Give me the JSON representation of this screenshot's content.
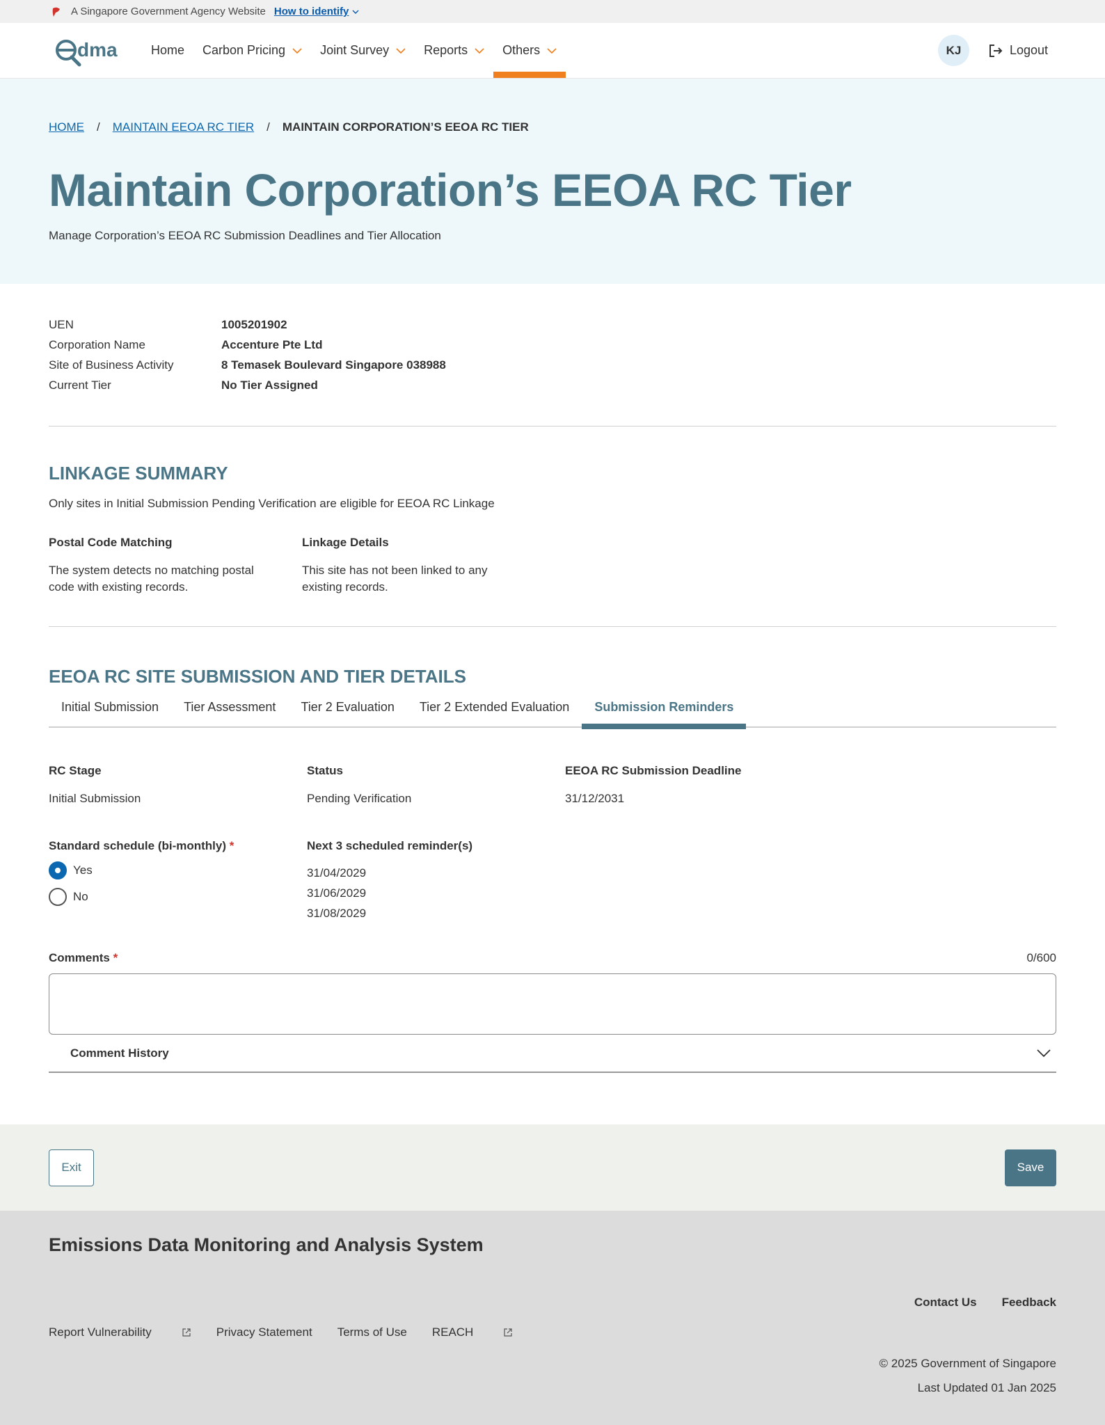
{
  "masthead": {
    "text": "A Singapore Government Agency Website",
    "identify_link": "How to identify"
  },
  "nav": {
    "logo_text": "edma",
    "items": [
      {
        "label": "Home",
        "dropdown": false
      },
      {
        "label": "Carbon Pricing",
        "dropdown": true
      },
      {
        "label": "Joint Survey",
        "dropdown": true
      },
      {
        "label": "Reports",
        "dropdown": true
      },
      {
        "label": "Others",
        "dropdown": true,
        "active": true
      }
    ],
    "avatar_initials": "KJ",
    "logout_label": "Logout"
  },
  "breadcrumb": {
    "home": "HOME",
    "parent": "MAINTAIN EEOA RC TIER",
    "current": "MAINTAIN CORPORATION’S EEOA RC TIER",
    "separator": "/"
  },
  "page": {
    "title": "Maintain Corporation’s EEOA RC Tier",
    "subtitle": "Manage Corporation’s EEOA RC Submission Deadlines and Tier Allocation"
  },
  "info": [
    {
      "label": "UEN",
      "value": "1005201902"
    },
    {
      "label": "Corporation Name",
      "value": "Accenture Pte Ltd"
    },
    {
      "label": "Site of Business Activity",
      "value": "8 Temasek Boulevard Singapore 038988"
    },
    {
      "label": "Current Tier",
      "value": "No Tier Assigned"
    }
  ],
  "linkage": {
    "title": "LINKAGE SUMMARY",
    "note": "Only sites in Initial Submission Pending Verification are eligible for EEOA RC Linkage",
    "postal_title": "Postal Code Matching",
    "postal_text": "The system detects no matching postal code with existing records.",
    "details_title": "Linkage Details",
    "details_text": "This site has not been linked to any existing records."
  },
  "submission": {
    "title": "EEOA RC SITE SUBMISSION AND TIER DETAILS",
    "tabs": [
      "Initial Submission",
      "Tier Assessment",
      "Tier 2 Evaluation",
      "Tier 2 Extended Evaluation",
      "Submission Reminders"
    ],
    "active_tab": "Submission Reminders",
    "rc_stage_label": "RC Stage",
    "rc_stage_value": "Initial Submission",
    "status_label": "Status",
    "status_value": "Pending Verification",
    "deadline_label": "EEOA RC Submission Deadline",
    "deadline_value": "31/12/2031",
    "schedule_label": "Standard schedule (bi-monthly)",
    "required_mark": "*",
    "yes_label": "Yes",
    "no_label": "No",
    "selected": "Yes",
    "reminders_label": "Next 3 scheduled reminder(s)",
    "reminders": [
      "31/04/2029",
      "31/06/2029",
      "31/08/2029"
    ],
    "comments_label": "Comments",
    "comments_count": "0/600",
    "comments_value": "",
    "history_label": "Comment History"
  },
  "actions": {
    "exit_label": "Exit",
    "save_label": "Save"
  },
  "footer": {
    "title": "Emissions Data Monitoring and Analysis System",
    "contact": "Contact Us",
    "feedback": "Feedback",
    "report_vulnerability": "Report Vulnerability",
    "privacy": "Privacy Statement",
    "terms": "Terms of Use",
    "reach": "REACH",
    "copyright": "© 2025 Government of Singapore",
    "last_updated": "Last Updated 01 Jan 2025"
  },
  "colors": {
    "accent": "#4a7587",
    "nav_active": "#f07f1d",
    "link": "#0b68b0",
    "required": "#d0342c"
  }
}
